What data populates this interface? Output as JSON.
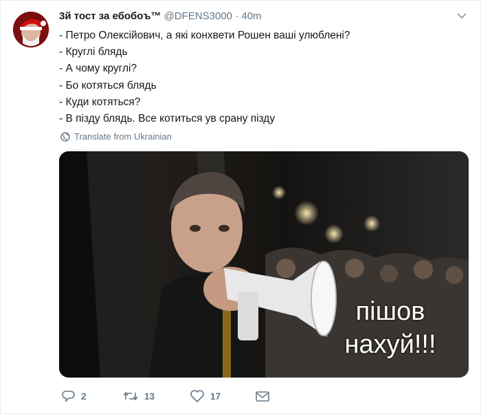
{
  "tweet": {
    "author_name": "3й тост за ебобоъ™",
    "handle": "@DFENS3000",
    "separator": "·",
    "time": "40m",
    "lines": [
      "- Петро Олексійович, а які конхвети Рошен ваші улюблені?",
      "- Круглі блядь",
      "- А чому круглі?",
      "- Бо котяться блядь",
      "- Куди котяться?",
      "- В пізду блядь. Все котиться ув срану пізду"
    ],
    "translate_label": "Translate from Ukrainian",
    "image_caption_line1": "пішов",
    "image_caption_line2": "нахуй!!!"
  },
  "actions": {
    "reply_count": "2",
    "retweet_count": "13",
    "like_count": "17"
  },
  "icons": {
    "menu": "chevron-down-icon",
    "globe": "globe-icon",
    "reply": "reply-icon",
    "retweet": "retweet-icon",
    "like": "heart-icon",
    "dm": "envelope-icon"
  },
  "colors": {
    "text": "#14171a",
    "muted": "#657786",
    "border": "#e6ecf0"
  }
}
